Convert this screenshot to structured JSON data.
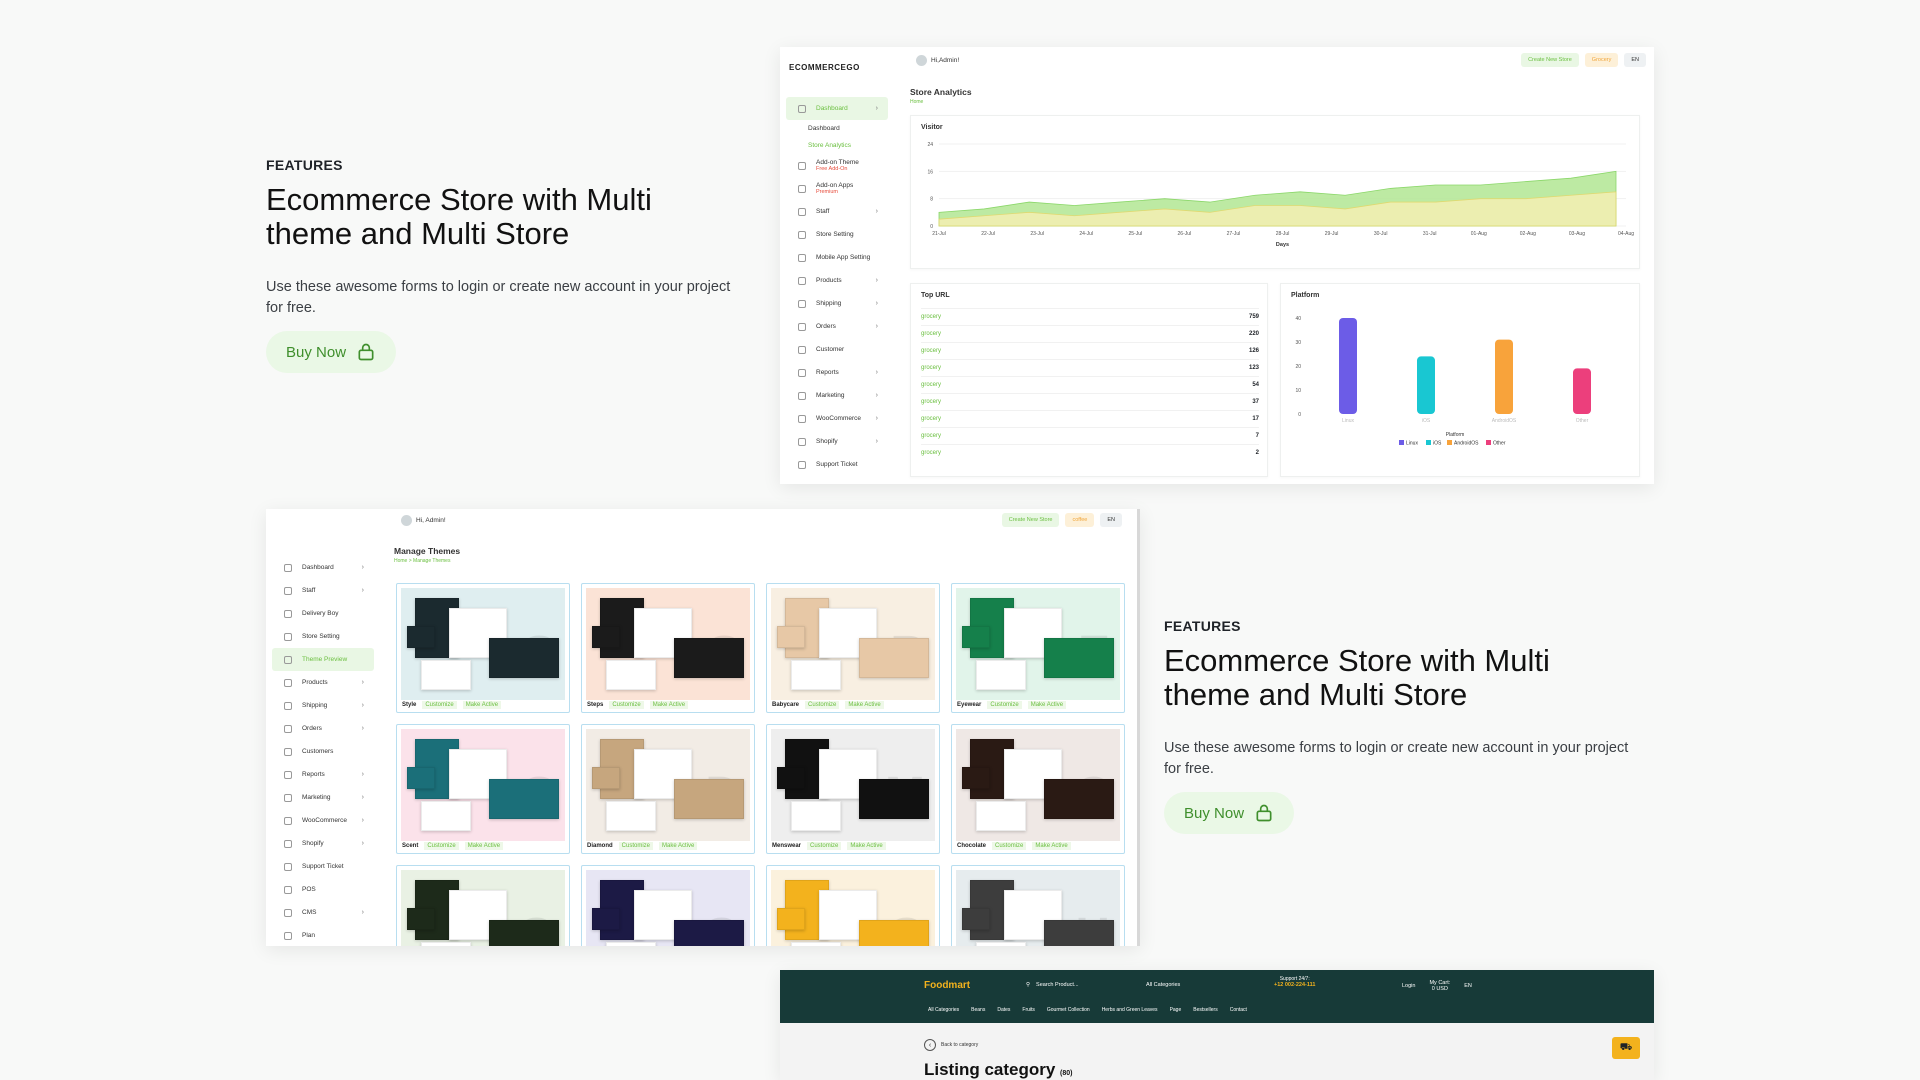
{
  "features": [
    {
      "eyebrow": "FEATURES",
      "title": "Ecommerce Store with Multi theme and Multi Store",
      "desc": "Use these awesome forms to login or create new account in your project for free.",
      "button": "Buy Now"
    },
    {
      "eyebrow": "FEATURES",
      "title": "Ecommerce Store with Multi theme and Multi Store",
      "desc": "Use these awesome forms to login or create new account in your project for free.",
      "button": "Buy Now"
    }
  ],
  "analytics": {
    "logo": "ECOMMERCEGO",
    "user": "Hi,Admin!",
    "create_store": "Create New Store",
    "store_select": "Grocery",
    "lang": "EN",
    "page_title": "Store Analytics",
    "breadcrumb": "Home",
    "sidebar": [
      {
        "label": "Dashboard",
        "active": true
      },
      {
        "label": "Dashboard",
        "sub": true
      },
      {
        "label": "Store Analytics",
        "sub": true,
        "active_sub": true
      },
      {
        "label": "Add-on Theme",
        "badge": "Free Add-On"
      },
      {
        "label": "Add-on Apps",
        "badge": "Premium"
      },
      {
        "label": "Staff"
      },
      {
        "label": "Store Setting"
      },
      {
        "label": "Mobile App Setting"
      },
      {
        "label": "Products"
      },
      {
        "label": "Shipping"
      },
      {
        "label": "Orders"
      },
      {
        "label": "Customer"
      },
      {
        "label": "Reports"
      },
      {
        "label": "Marketing"
      },
      {
        "label": "WooCommerce"
      },
      {
        "label": "Shopify"
      },
      {
        "label": "Support Ticket"
      }
    ],
    "visitor_title": "Visitor",
    "visitor_axis_label": "Days",
    "top_url_title": "Top URL",
    "top_urls": [
      {
        "url": "grocery",
        "count": "759"
      },
      {
        "url": "grocery",
        "count": "220"
      },
      {
        "url": "grocery",
        "count": "126"
      },
      {
        "url": "grocery",
        "count": "123"
      },
      {
        "url": "grocery",
        "count": "54"
      },
      {
        "url": "grocery",
        "count": "37"
      },
      {
        "url": "grocery",
        "count": "17"
      },
      {
        "url": "grocery",
        "count": "7"
      },
      {
        "url": "grocery",
        "count": "2"
      }
    ],
    "platform_title": "Platform"
  },
  "chart_data": [
    {
      "type": "area",
      "title": "Visitor",
      "xlabel": "Days",
      "ylabel": "",
      "x": [
        "21-Jul",
        "22-Jul",
        "23-Jul",
        "24-Jul",
        "25-Jul",
        "26-Jul",
        "27-Jul",
        "28-Jul",
        "29-Jul",
        "30-Jul",
        "31-Jul",
        "01-Aug",
        "02-Aug",
        "03-Aug",
        "04-Aug"
      ],
      "ylim": [
        0,
        24
      ],
      "yticks": [
        0,
        8,
        16,
        24
      ],
      "series": [
        {
          "values": [
            4,
            5,
            7,
            6,
            7,
            8,
            7,
            9,
            10,
            9,
            11,
            12,
            12,
            13,
            14,
            16
          ],
          "color": "#b6e89a"
        },
        {
          "values": [
            2,
            3,
            4,
            3,
            4,
            5,
            4,
            6,
            6,
            5,
            7,
            7,
            8,
            8,
            9,
            10
          ],
          "color": "#f2efb2"
        }
      ]
    },
    {
      "type": "bar",
      "title": "Platform",
      "categories": [
        "Linux",
        "iOS",
        "AndroidOS",
        "Other"
      ],
      "values": [
        40,
        24,
        31,
        19
      ],
      "colors": [
        "#6c5ce7",
        "#19c7d2",
        "#f8a33b",
        "#ec3f7c"
      ],
      "ylim": [
        0,
        40
      ],
      "yticks": [
        0,
        10,
        20,
        30,
        40
      ],
      "legend_title": "Platform",
      "legend": [
        "Linux",
        "iOS",
        "AndroidOS",
        "Other"
      ]
    }
  ],
  "themes_page": {
    "user": "Hi, Admin!",
    "create_store": "Create New Store",
    "store_select": "coffee",
    "lang": "EN",
    "page_title": "Manage Themes",
    "breadcrumb": "Home  >  Manage Themes",
    "sidebar": [
      {
        "label": "Dashboard",
        "chev": true
      },
      {
        "label": "Staff",
        "chev": true
      },
      {
        "label": "Delivery Boy"
      },
      {
        "label": "Store Setting"
      },
      {
        "label": "Theme Preview",
        "active": true
      },
      {
        "label": "Products",
        "chev": true
      },
      {
        "label": "Shipping",
        "chev": true
      },
      {
        "label": "Orders",
        "chev": true
      },
      {
        "label": "Customers"
      },
      {
        "label": "Reports",
        "chev": true
      },
      {
        "label": "Marketing",
        "chev": true
      },
      {
        "label": "WooCommerce",
        "chev": true
      },
      {
        "label": "Shopify",
        "chev": true
      },
      {
        "label": "Support Ticket"
      },
      {
        "label": "POS"
      },
      {
        "label": "CMS",
        "chev": true
      },
      {
        "label": "Plan"
      }
    ],
    "customize": "Customize",
    "make_active": "Make Active",
    "themes": [
      {
        "name": "Style",
        "bg": "#dfeef0",
        "dark": "#1b2a2f",
        "letter": "S"
      },
      {
        "name": "Steps",
        "bg": "#fbe3d6",
        "dark": "#1b1b1b",
        "letter": "S"
      },
      {
        "name": "Babycare",
        "bg": "#f8efe2",
        "dark": "#e7c8a6",
        "letter": "B"
      },
      {
        "name": "Eyewear",
        "bg": "#e1f4ea",
        "dark": "#15804b",
        "letter": "E"
      },
      {
        "name": "Scent",
        "bg": "#fbe2ea",
        "dark": "#1b6f79",
        "letter": "S"
      },
      {
        "name": "Diamond",
        "bg": "#f2ece5",
        "dark": "#c6a67e",
        "letter": "D"
      },
      {
        "name": "Menswear",
        "bg": "#eeeeee",
        "dark": "#111111",
        "letter": "M"
      },
      {
        "name": "Chocolate",
        "bg": "#efe8e5",
        "dark": "#2a1a14",
        "letter": "C"
      },
      {
        "name": "",
        "bg": "#e9f1e4",
        "dark": "#1d2a1a",
        "letter": "G"
      },
      {
        "name": "",
        "bg": "#e7e6f4",
        "dark": "#1c1a45",
        "letter": "G"
      },
      {
        "name": "",
        "bg": "#fbf1dd",
        "dark": "#f3b21d",
        "letter": "G"
      },
      {
        "name": "",
        "bg": "#e6ecee",
        "dark": "#3d3d3d",
        "letter": "H"
      }
    ]
  },
  "foodmart": {
    "logo": "Foodmart",
    "search_placeholder": "Search Product...",
    "all_categories": "All Categories",
    "support_label": "Support 24/7:",
    "support_phone": "+12 002-224-111",
    "login": "Login",
    "cart_label": "My Cart:",
    "cart_value": "0 USD",
    "lang": "EN",
    "nav": [
      "All Categories",
      "Beans",
      "Dates",
      "Fruits",
      "Gourmet Collection",
      "Herbs and Green Leaves",
      "Page",
      "Bestsellers",
      "Contact"
    ],
    "back": "Back to category",
    "heading": "Listing category",
    "heading_count": "(80)"
  }
}
